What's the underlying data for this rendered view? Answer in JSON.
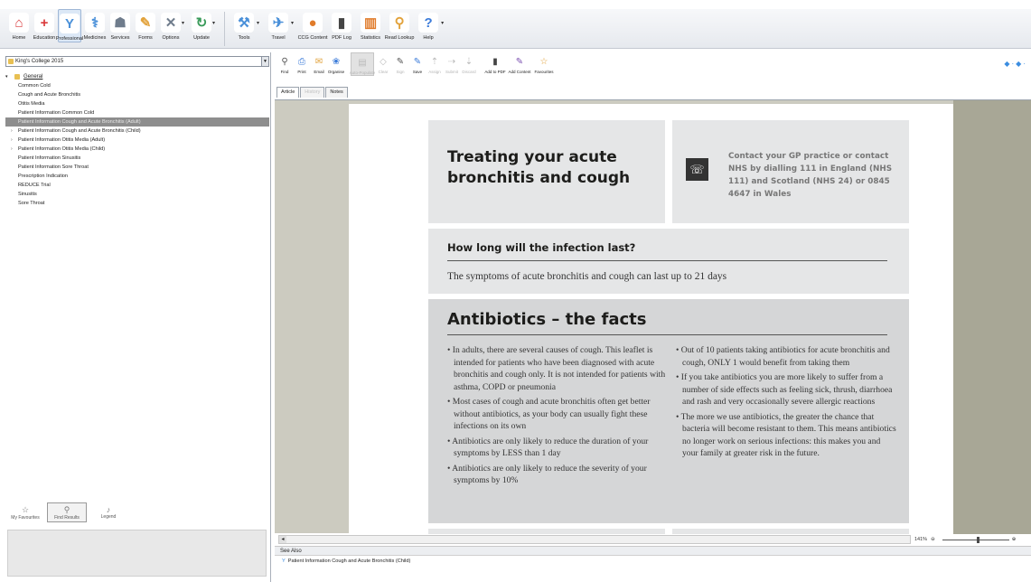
{
  "toolbar": {
    "items": [
      {
        "label": "Home",
        "icon": "home-icon",
        "color": "#d9383a"
      },
      {
        "label": "Education",
        "icon": "education-icon",
        "color": "#d9383a"
      },
      {
        "label": "Professional",
        "icon": "professional-icon",
        "color": "#4a90d9"
      },
      {
        "label": "Medicines",
        "icon": "medicines-icon",
        "color": "#4a90d9"
      },
      {
        "label": "Services",
        "icon": "services-icon",
        "color": "#6f7c8c"
      },
      {
        "label": "Forms",
        "icon": "forms-icon",
        "color": "#e2a23b"
      },
      {
        "label": "Options",
        "icon": "options-icon",
        "color": "#6f7c8c"
      },
      {
        "label": "Update",
        "icon": "update-icon",
        "color": "#3a9b5a"
      },
      {
        "label": "Tools",
        "icon": "tools-icon",
        "color": "#4a90d9"
      },
      {
        "label": "Travel",
        "icon": "travel-icon",
        "color": "#4a90d9"
      },
      {
        "label": "CCG Content",
        "icon": "ccg-content-icon",
        "color": "#e07b2a"
      },
      {
        "label": "PDF Log",
        "icon": "pdf-log-icon",
        "color": "#444444"
      },
      {
        "label": "Statistics",
        "icon": "statistics-icon",
        "color": "#e07b2a"
      },
      {
        "label": "Read Lookup",
        "icon": "read-lookup-icon",
        "color": "#e2a23b"
      },
      {
        "label": "Help",
        "icon": "help-icon",
        "color": "#3b7bd9"
      }
    ]
  },
  "sidebar": {
    "organisation": "King's College 2015",
    "root": "General",
    "items": [
      {
        "label": "Common Cold",
        "expandable": false,
        "selected": false
      },
      {
        "label": "Cough and Acute Bronchitis",
        "expandable": false,
        "selected": false
      },
      {
        "label": "Otitis Media",
        "expandable": false,
        "selected": false
      },
      {
        "label": "Patient Information Common Cold",
        "expandable": false,
        "selected": false
      },
      {
        "label": "Patient Information Cough and Acute Bronchitis (Adult)",
        "expandable": false,
        "selected": true
      },
      {
        "label": "Patient Information Cough and Acute Bronchitis (Child)",
        "expandable": true,
        "selected": false
      },
      {
        "label": "Patient Information Otitis Media (Adult)",
        "expandable": true,
        "selected": false
      },
      {
        "label": "Patient Information Otitis Media (Child)",
        "expandable": true,
        "selected": false
      },
      {
        "label": "Patient Information Sinusitis",
        "expandable": false,
        "selected": false
      },
      {
        "label": "Patient Information Sore Throat",
        "expandable": false,
        "selected": false
      },
      {
        "label": "Prescription Indication",
        "expandable": false,
        "selected": false
      },
      {
        "label": "REDUCE Trial",
        "expandable": false,
        "selected": false
      },
      {
        "label": "Sinusitis",
        "expandable": false,
        "selected": false
      },
      {
        "label": "Sore Throat",
        "expandable": false,
        "selected": false
      }
    ],
    "tabs": [
      {
        "label": "My Favourites",
        "icon": "star-icon",
        "active": false
      },
      {
        "label": "Find Results",
        "icon": "binoculars-icon",
        "active": true
      },
      {
        "label": "Legend",
        "icon": "legend-icon",
        "active": false
      }
    ]
  },
  "toolbar2": {
    "items": [
      {
        "label": "Find",
        "disabled": false
      },
      {
        "label": "Print",
        "disabled": false
      },
      {
        "label": "Email",
        "disabled": false
      },
      {
        "label": "Organise",
        "disabled": false
      },
      {
        "label": "Auto-Populate",
        "disabled": true
      },
      {
        "label": "Clear",
        "disabled": true
      },
      {
        "label": "Sign",
        "disabled": true
      },
      {
        "label": "Save",
        "disabled": false
      },
      {
        "label": "Assign",
        "disabled": true
      },
      {
        "label": "Submit",
        "disabled": true
      },
      {
        "label": "Discard",
        "disabled": true
      },
      {
        "label": "Add to PDF",
        "disabled": false
      },
      {
        "label": "Add Content",
        "disabled": false
      },
      {
        "label": "Favourites",
        "disabled": false
      }
    ]
  },
  "doc_tabs": [
    {
      "label": "Article",
      "active": true,
      "disabled": false
    },
    {
      "label": "History",
      "active": false,
      "disabled": true
    },
    {
      "label": "Notes",
      "active": false,
      "disabled": false
    }
  ],
  "document": {
    "title": "Treating your acute bronchitis and cough",
    "contact": "Contact your GP practice or contact NHS by dialling 111 in England (NHS 111) and Scotland (NHS 24) or 0845 4647 in Wales",
    "duration_heading": "How long will the infection last?",
    "duration_text": "The symptoms of acute bronchitis and cough can last up to 21 days",
    "facts_heading": "Antibiotics – the facts",
    "facts_left": [
      "In adults, there are several causes of cough. This leaflet is intended for patients who have been diagnosed with acute bronchitis and cough only. It is not intended for patients with asthma, COPD or pneumonia",
      "Most cases of cough and acute bronchitis often get better without antibiotics, as your body can usually fight these infections on its own",
      "Antibiotics are only likely to reduce the duration of your symptoms by LESS than 1 day",
      "Antibiotics are only likely to reduce the severity of your symptoms by 10%"
    ],
    "facts_right": [
      "Out of 10 patients taking antibiotics for acute bronchitis and cough, ONLY 1 would benefit from taking them",
      "If you take antibiotics you are more likely to suffer from a number of side effects such as feeling sick, thrush, diarrhoea and rash and very occasionally severe allergic reactions",
      "The more we use antibiotics, the greater the chance that bacteria will become resistant to them. This means antibiotics no longer work on serious infections: this makes you and your family at greater risk in the future."
    ]
  },
  "zoom": "141%",
  "see_also": {
    "header": "See Also",
    "link": "Patient Information Cough and Acute Bronchitis (Child)"
  }
}
